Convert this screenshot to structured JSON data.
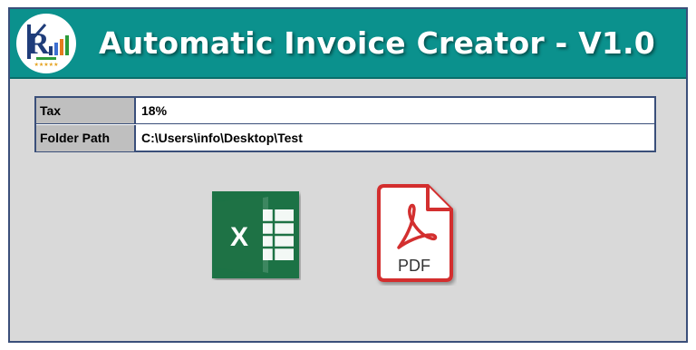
{
  "header": {
    "title": "Automatic Invoice Creator - V1.0",
    "background": "#0b918d",
    "logo_icon": "pk-logo-icon"
  },
  "settings": {
    "rows": [
      {
        "label": "Tax",
        "value": "18%"
      },
      {
        "label": "Folder Path",
        "value": "C:\\Users\\info\\Desktop\\Test"
      }
    ]
  },
  "actions": {
    "excel": {
      "icon": "excel-icon",
      "glyph": "X",
      "color": "#1e7245"
    },
    "pdf": {
      "icon": "pdf-icon",
      "label": "PDF",
      "color": "#d32f2f"
    }
  }
}
